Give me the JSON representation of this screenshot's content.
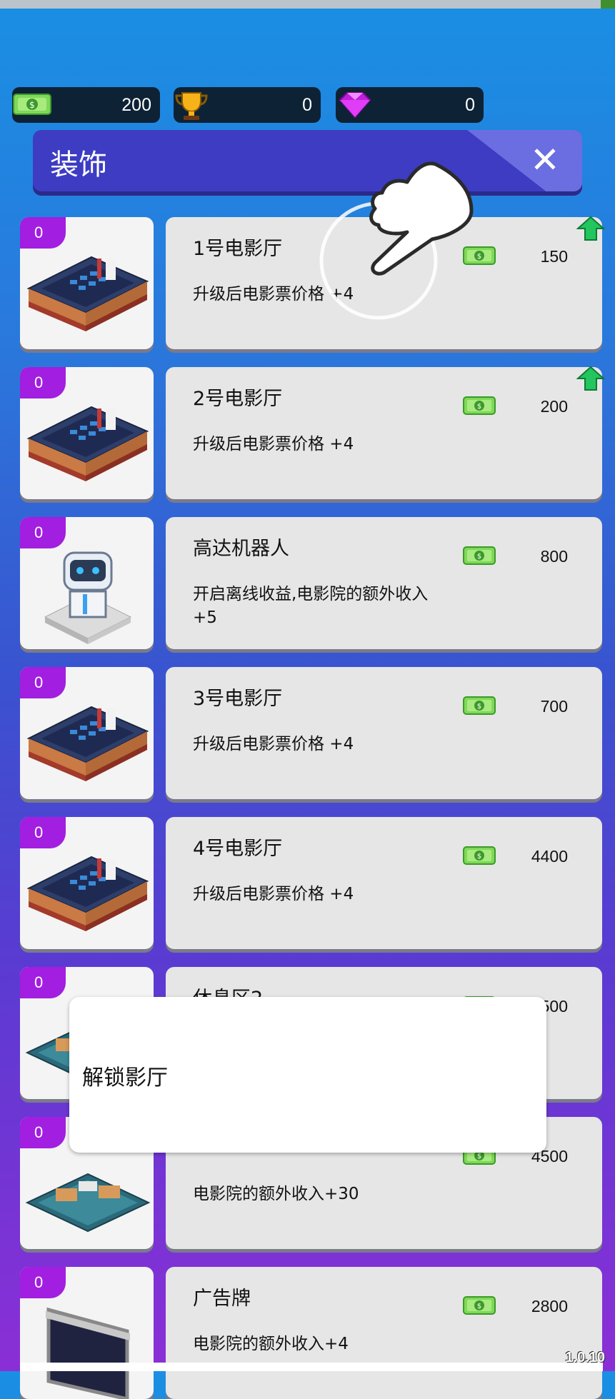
{
  "resources": {
    "cash": "200",
    "trophies": "0",
    "gems": "0"
  },
  "header": {
    "title": "装饰"
  },
  "items": [
    {
      "count": "0",
      "name": "1号电影厅",
      "desc": "升级后电影票价格 +4",
      "price": "150",
      "upgrade": true
    },
    {
      "count": "0",
      "name": "2号电影厅",
      "desc": "升级后电影票价格 +4",
      "price": "200",
      "upgrade": true
    },
    {
      "count": "0",
      "name": "高达机器人",
      "desc": "开启离线收益,电影院的额外收入 +5",
      "price": "800",
      "upgrade": false
    },
    {
      "count": "0",
      "name": "3号电影厅",
      "desc": "升级后电影票价格 +4",
      "price": "700",
      "upgrade": false
    },
    {
      "count": "0",
      "name": "4号电影厅",
      "desc": "升级后电影票价格 +4",
      "price": "4400",
      "upgrade": false
    },
    {
      "count": "0",
      "name": "休息区2",
      "desc": "",
      "price": "1500",
      "upgrade": false
    },
    {
      "count": "0",
      "name": "",
      "desc": "电影院的额外收入+30",
      "price": "4500",
      "upgrade": false
    },
    {
      "count": "0",
      "name": "广告牌",
      "desc": "电影院的额外收入+4",
      "price": "2800",
      "upgrade": false
    }
  ],
  "popup": {
    "text": "解锁影厅"
  },
  "version": "1.0.10",
  "colors": {
    "badge": "#a21ee0",
    "header": "#3d3cc3",
    "card": "#e6e6e6",
    "upgrade_arrow": "#22c55e"
  }
}
